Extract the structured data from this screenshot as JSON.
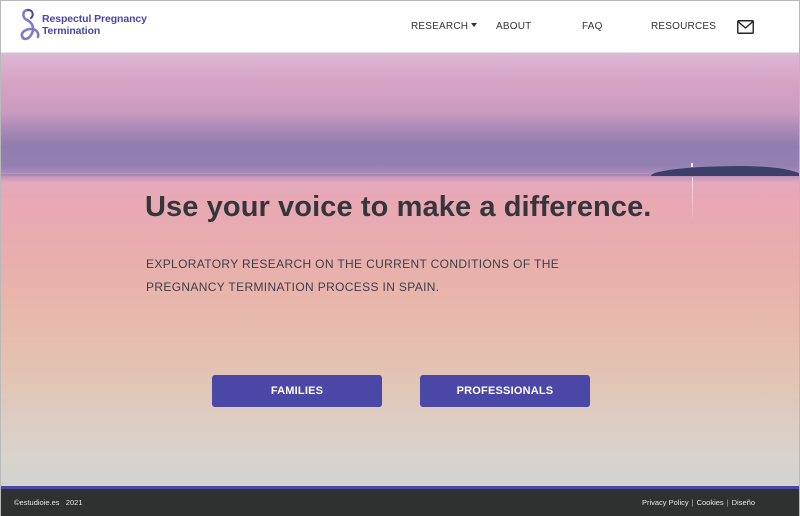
{
  "header": {
    "logo_line1": "Respectul Pregnancy",
    "logo_line2": "Termination",
    "nav": {
      "research": "RESEARCH",
      "about": "ABOUT",
      "faq": "FAQ",
      "resources": "RESOURCES"
    },
    "mail_icon": "envelope-icon"
  },
  "hero": {
    "title": "Use your voice to make a difference.",
    "subtitle": "EXPLORATORY RESEARCH ON THE CURRENT CONDITIONS OF THE PREGNANCY TERMINATION PROCESS IN SPAIN.",
    "buttons": {
      "families": "FAMILIES",
      "professionals": "PROFESSIONALS"
    }
  },
  "footer": {
    "copyright": "©estudioie.es   2021",
    "links": {
      "privacy": "Privacy Policy",
      "cookies": "Cookies",
      "design": "Diseño",
      "separator": "|"
    }
  },
  "colors": {
    "accent": "#4b47a6",
    "footer_bg": "#2f3030"
  }
}
